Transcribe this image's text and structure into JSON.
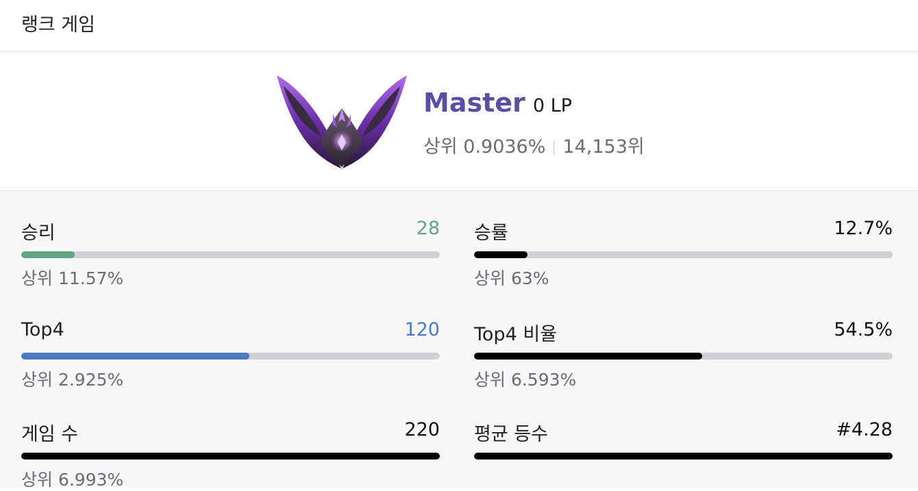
{
  "header": {
    "title": "랭크 게임"
  },
  "tier": {
    "name": "Master",
    "lp": "0 LP",
    "top_percent": "상위 0.9036%",
    "rank": "14,153위",
    "emblem_icon": "master-emblem-icon",
    "name_color": "#5e4ea3"
  },
  "stats": [
    {
      "label": "승리",
      "value": "28",
      "sub": "상위 11.57%",
      "fill_fraction": 0.127,
      "color": "#63a57f"
    },
    {
      "label": "승률",
      "value": "12.7%",
      "sub": "상위 63%",
      "fill_fraction": 0.127,
      "color": "#000000"
    },
    {
      "label": "Top4",
      "value": "120",
      "sub": "상위 2.925%",
      "fill_fraction": 0.545,
      "color": "#4d78c4"
    },
    {
      "label": "Top4 비율",
      "value": "54.5%",
      "sub": "상위 6.593%",
      "fill_fraction": 0.545,
      "color": "#000000"
    },
    {
      "label": "게임 수",
      "value": "220",
      "sub": "상위 6.993%",
      "fill_fraction": 1.0,
      "color": "#000000"
    },
    {
      "label": "평균 등수",
      "value": "#4.28",
      "sub": "",
      "fill_fraction": 1.0,
      "color": "#000000"
    }
  ]
}
